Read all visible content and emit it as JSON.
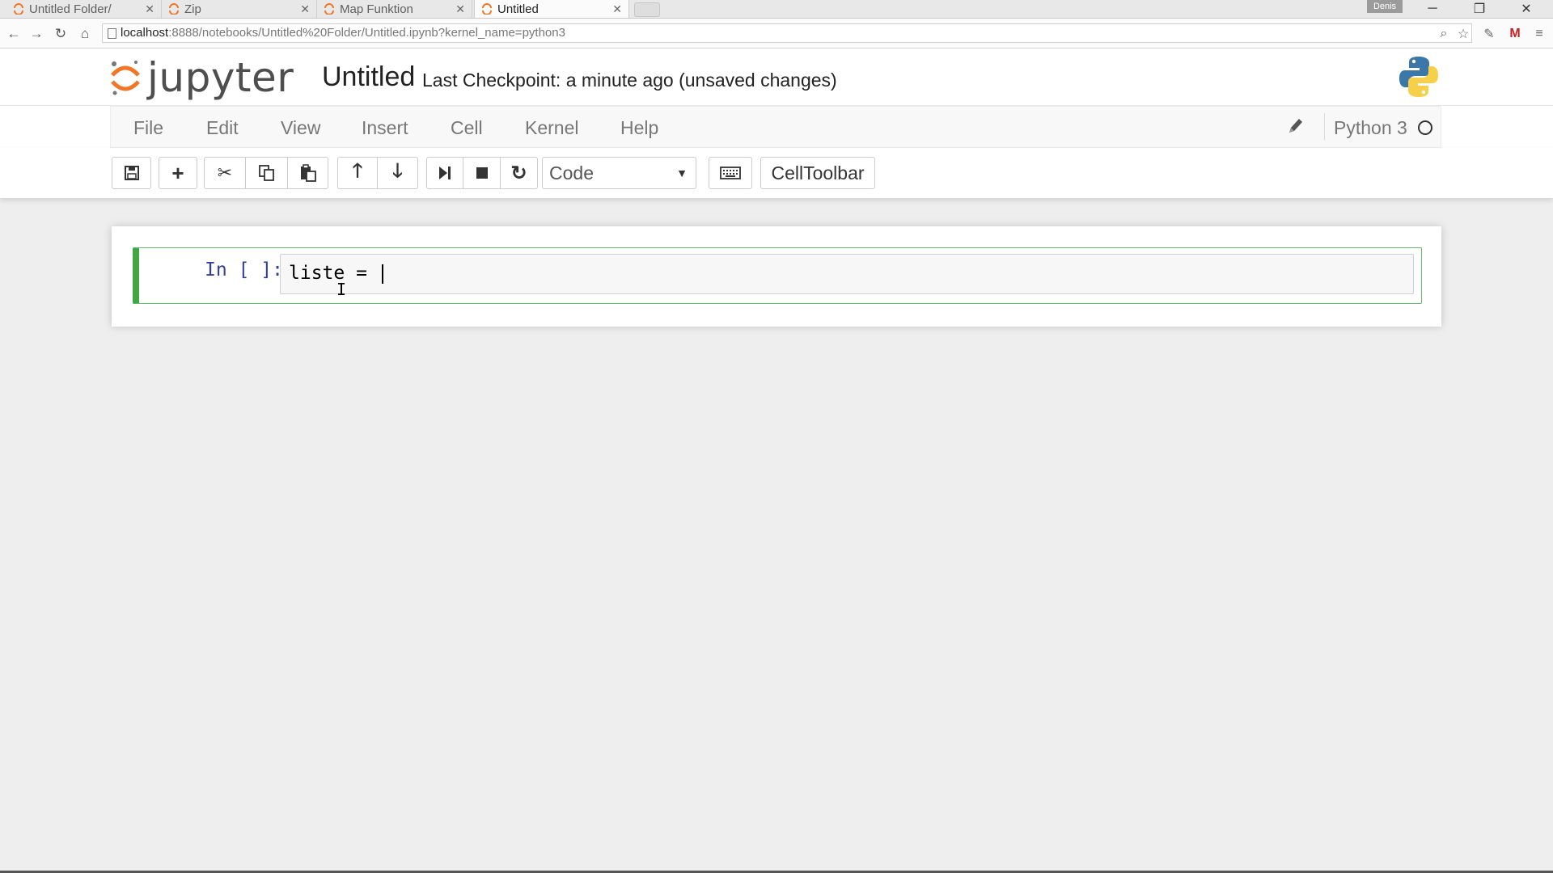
{
  "browser": {
    "tabs": [
      {
        "label": "Untitled Folder/",
        "active": false
      },
      {
        "label": "Zip",
        "active": false
      },
      {
        "label": "Map Funktion",
        "active": false
      },
      {
        "label": "Untitled",
        "active": true
      }
    ],
    "user_badge": "Denis",
    "url_host": "localhost",
    "url_rest": ":8888/notebooks/Untitled%20Folder/Untitled.ipynb?kernel_name=python3"
  },
  "header": {
    "logo_text": "jupyter",
    "notebook_name": "Untitled",
    "checkpoint": "Last Checkpoint: a minute ago (unsaved changes)"
  },
  "menu": {
    "items": [
      "File",
      "Edit",
      "View",
      "Insert",
      "Cell",
      "Kernel",
      "Help"
    ],
    "kernel_name": "Python 3"
  },
  "toolbar": {
    "cell_type": "Code",
    "celltoolbar_label": "CellToolbar"
  },
  "cell": {
    "prompt": "In [ ]:",
    "code": "liste = "
  },
  "colors": {
    "cell_border_active": "#42a742",
    "prompt": "#303f9f",
    "jupyter_orange": "#f37626"
  }
}
